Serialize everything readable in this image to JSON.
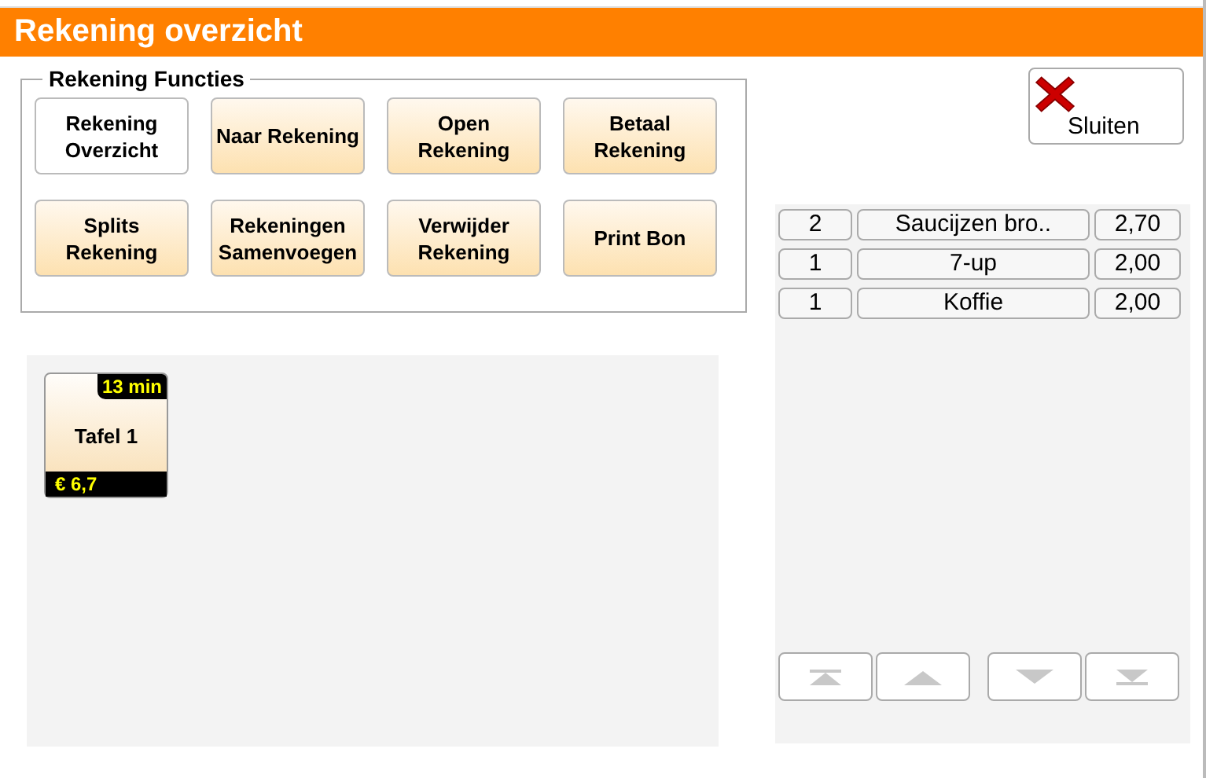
{
  "window": {
    "title": "Rekening overzicht"
  },
  "functions": {
    "title": "Rekening Functies",
    "buttons": [
      {
        "label": "Rekening Overzicht",
        "selected": true
      },
      {
        "label": "Naar Rekening",
        "selected": false
      },
      {
        "label": "Open Rekening",
        "selected": false
      },
      {
        "label": "Betaal Rekening",
        "selected": false
      },
      {
        "label": "Splits Rekening",
        "selected": false
      },
      {
        "label": "Rekeningen Samenvoegen",
        "selected": false
      },
      {
        "label": "Verwijder Rekening",
        "selected": false
      },
      {
        "label": "Print Bon",
        "selected": false
      }
    ]
  },
  "close_button": {
    "label": "Sluiten"
  },
  "tables": [
    {
      "name": "Tafel 1",
      "time": "13 min",
      "amount": "€ 6,7"
    }
  ],
  "order_lines": [
    {
      "quantity": "2",
      "item": "Saucijzen bro..",
      "price": "2,70"
    },
    {
      "quantity": "1",
      "item": "7-up",
      "price": "2,00"
    },
    {
      "quantity": "1",
      "item": "Koffie",
      "price": "2,00"
    }
  ],
  "scroll_buttons": [
    {
      "kind": "top"
    },
    {
      "kind": "up"
    },
    {
      "kind": "down"
    },
    {
      "kind": "bottom"
    }
  ]
}
